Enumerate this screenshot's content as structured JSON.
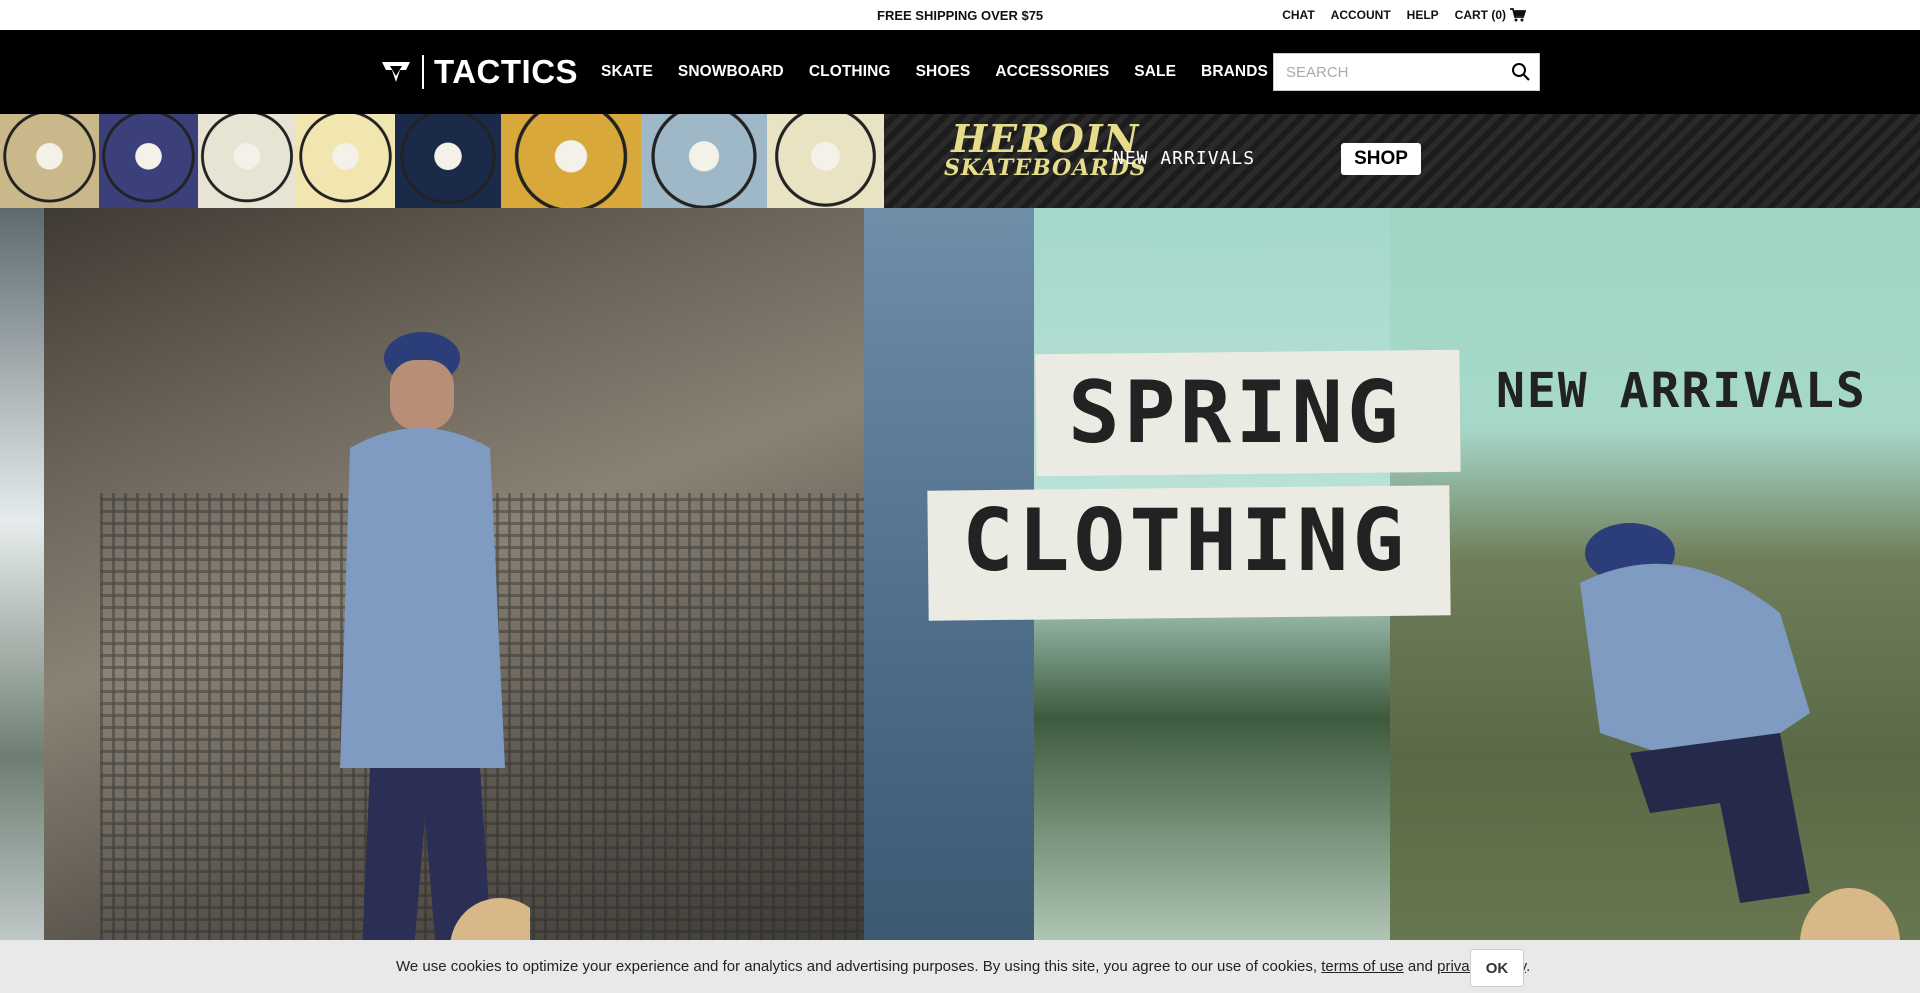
{
  "topbar": {
    "shipping": "FREE SHIPPING OVER $75",
    "chat": "CHAT",
    "account": "ACCOUNT",
    "help": "HELP",
    "cart": "CART (0)"
  },
  "nav": {
    "logo": "TACTICS",
    "menu": [
      "SKATE",
      "SNOWBOARD",
      "CLOTHING",
      "SHOES",
      "ACCESSORIES",
      "SALE",
      "BRANDS"
    ],
    "search_placeholder": "SEARCH"
  },
  "promo": {
    "brand_line1": "HEROIN",
    "brand_line2": "SKATEBOARDS",
    "tagline": "NEW ARRIVALS",
    "button": "SHOP",
    "art_colors": [
      "#c9b98a",
      "#3b3f7a",
      "#e8e4d4",
      "#f2e6b0",
      "#1c2a4a",
      "#d8a93a",
      "#9fb8c8",
      "#e9e3c4"
    ]
  },
  "hero": {
    "line1": "SPRING",
    "line2": "CLOTHING",
    "tag": "NEW ARRIVALS"
  },
  "cookie": {
    "text_before": "We use cookies to optimize your experience and for analytics and advertising purposes. By using this site, you agree to our use of cookies, ",
    "terms": "terms of use",
    "and": " and ",
    "privacy": "privacy policy",
    "period": ".",
    "ok": "OK"
  }
}
